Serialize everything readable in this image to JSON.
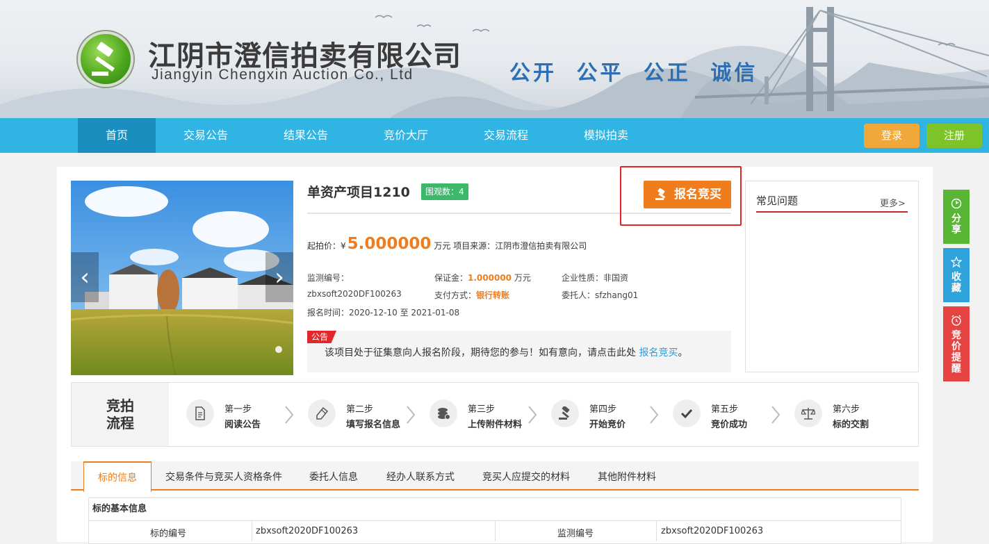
{
  "header": {
    "company_cn": "江阴市澄信拍卖有限公司",
    "company_en": "Jiangyin Chengxin Auction Co., Ltd",
    "slogan": "公开 公平 公正 诚信"
  },
  "nav": {
    "items": [
      {
        "label": "首页",
        "active": true
      },
      {
        "label": "交易公告"
      },
      {
        "label": "结果公告"
      },
      {
        "label": "竞价大厅"
      },
      {
        "label": "交易流程"
      },
      {
        "label": "模拟拍卖"
      }
    ],
    "login_label": "登录",
    "register_label": "注册"
  },
  "item": {
    "title": "单资产项目1210",
    "views": "围观数：4",
    "signup_label": "报名竞买",
    "start_price_label": "起拍价：",
    "currency": "¥",
    "start_price": "5.000000",
    "price_unit_source": "万元  项目来源：江阴市澄信拍卖有限公司",
    "monitor_no_label": "监测编号：",
    "monitor_no": "zbxsoft2020DF100263",
    "deposit_label": "保证金：",
    "deposit": "1.000000",
    "deposit_unit": "万元",
    "payment_label": "支付方式：",
    "payment": "银行转账",
    "enterprise_label": "企业性质：",
    "enterprise": "非国资",
    "consignor_label": "委托人：",
    "consignor": "sfzhang01",
    "signup_time_label": "报名时间：",
    "signup_time": "2020-12-10 至 2021-01-08"
  },
  "notice": {
    "tag": "公告",
    "text": "该项目处于征集意向人报名阶段，期待您的参与！如有意向，请点击此处 ",
    "link": "报名竞买",
    "end": "。"
  },
  "faq": {
    "title": "常见问题",
    "more": "更多>"
  },
  "side": {
    "share": "分享",
    "favorite": "收藏",
    "remind": "竞价提醒"
  },
  "process": {
    "label_line1": "竞拍",
    "label_line2": "流程",
    "steps": [
      {
        "num": "第一步",
        "name": "阅读公告",
        "icon": "document-icon"
      },
      {
        "num": "第二步",
        "name": "填写报名信息",
        "icon": "pencil-icon"
      },
      {
        "num": "第三步",
        "name": "上传附件材料",
        "icon": "coins-icon"
      },
      {
        "num": "第四步",
        "name": "开始竞价",
        "icon": "gavel-icon"
      },
      {
        "num": "第五步",
        "name": "竞价成功",
        "icon": "check-icon"
      },
      {
        "num": "第六步",
        "name": "标的交割",
        "icon": "scale-icon"
      }
    ]
  },
  "tabs": [
    {
      "label": "标的信息",
      "active": true
    },
    {
      "label": "交易条件与竞买人资格条件"
    },
    {
      "label": "委托人信息"
    },
    {
      "label": "经办人联系方式"
    },
    {
      "label": "竞买人应提交的材料"
    },
    {
      "label": "其他附件材料"
    }
  ],
  "table": {
    "section_title": "标的基本信息",
    "row1": [
      "标的编号",
      "zbxsoft2020DF100263",
      "监测编号",
      "zbxsoft2020DF100263"
    ]
  },
  "colors": {
    "nav_bg": "#2fb4e3",
    "nav_active": "#1a8fbf",
    "accent_orange": "#ef7d1d",
    "login_bg": "#f0a83a",
    "register_bg": "#7dc42a",
    "share_bg": "#58b535",
    "favorite_bg": "#2fa4dc",
    "remind_bg": "#e64343",
    "highlight_red": "#e62222"
  }
}
